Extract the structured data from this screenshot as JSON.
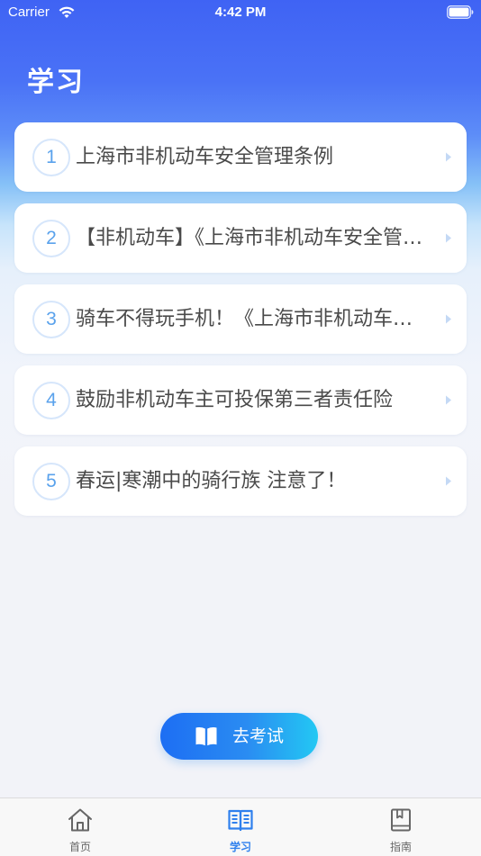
{
  "status_bar": {
    "carrier": "Carrier",
    "time": "4:42 PM"
  },
  "page": {
    "title": "学习"
  },
  "articles": [
    {
      "index": "1",
      "title": "上海市非机动车安全管理条例"
    },
    {
      "index": "2",
      "title": "【非机动车】《上海市非机动车安全管理条例》"
    },
    {
      "index": "3",
      "title": "骑车不得玩手机！《上海市非机动车安全管理条例》"
    },
    {
      "index": "4",
      "title": "鼓励非机动车主可投保第三者责任险"
    },
    {
      "index": "5",
      "title": "春运|寒潮中的骑行族 注意了！"
    }
  ],
  "exam_button": {
    "label": "去考试",
    "icon": "book-open-icon"
  },
  "tabbar": {
    "tabs": [
      {
        "label": "首页",
        "icon": "home-icon",
        "active": false
      },
      {
        "label": "学习",
        "icon": "study-book-icon",
        "active": true
      },
      {
        "label": "指南",
        "icon": "guide-book-icon",
        "active": false
      }
    ]
  },
  "colors": {
    "header_gradient_top": "#3f63f4",
    "accent": "#2f80ed",
    "number": "#5aa2ec",
    "tab_inactive": "#666666"
  }
}
